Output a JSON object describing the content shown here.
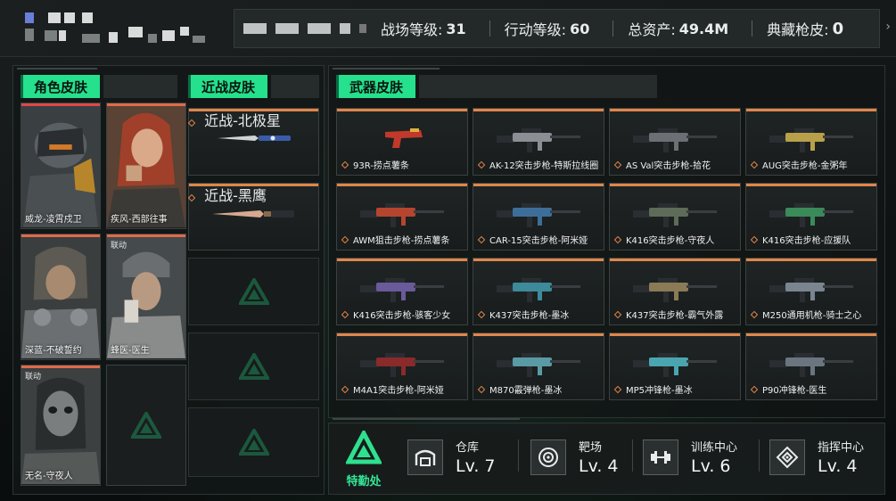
{
  "header": {
    "stats": [
      {
        "label": "战场等级:",
        "value": "31"
      },
      {
        "label": "行动等级:",
        "value": "60"
      },
      {
        "label": "总资产:",
        "value": "49.4M"
      },
      {
        "label": "典藏枪皮:",
        "value": "0"
      }
    ],
    "arrow_icon": "chevron-right-icon"
  },
  "sections": {
    "character": "角色皮肤",
    "melee": "近战皮肤",
    "weapon": "武器皮肤"
  },
  "characters": [
    {
      "name": "威龙-凌霄戍卫",
      "badge": ""
    },
    {
      "name": "疾风-西部往事",
      "badge": ""
    },
    {
      "name": "深蓝-不破誓约",
      "badge": ""
    },
    {
      "name": "蜂医-医生",
      "badge": "联动"
    },
    {
      "name": "无名-守夜人",
      "badge": "联动"
    }
  ],
  "melee": [
    {
      "name": "近战-北极星"
    },
    {
      "name": "近战-黑鹰"
    }
  ],
  "weapons": [
    {
      "name": "93R-捞点薯条",
      "color": "#c0392b"
    },
    {
      "name": "AK-12突击步枪-特斯拉线圈",
      "color": "#8a8f94"
    },
    {
      "name": "AS Val突击步枪-拾花",
      "color": "#6b7075"
    },
    {
      "name": "AUG突击步枪-金粥年",
      "color": "#b8a04a"
    },
    {
      "name": "AWM狙击步枪-捞点薯条",
      "color": "#b5452f"
    },
    {
      "name": "CAR-15突击步枪-阿米娅",
      "color": "#3d6e9a"
    },
    {
      "name": "K416突击步枪-守夜人",
      "color": "#5e6b58"
    },
    {
      "name": "K416突击步枪-应援队",
      "color": "#3a8a5a"
    },
    {
      "name": "K416突击步枪-骇客少女",
      "color": "#6a5a9a"
    },
    {
      "name": "K437突击步枪-墨冰",
      "color": "#3c8a9a"
    },
    {
      "name": "K437突击步枪-霸气外露",
      "color": "#8a7a55"
    },
    {
      "name": "M250通用机枪-骑士之心",
      "color": "#7a8590"
    },
    {
      "name": "M4A1突击步枪-阿米娅",
      "color": "#8a2a2a"
    },
    {
      "name": "M870霰弹枪-墨冰",
      "color": "#5a9aa5"
    },
    {
      "name": "MP5冲锋枪-墨冰",
      "color": "#4aa5b0"
    },
    {
      "name": "P90冲锋枪-医生",
      "color": "#6a7580"
    }
  ],
  "facilities": {
    "logo_label": "特勤处",
    "items": [
      {
        "name": "仓库",
        "level": "Lv. 7",
        "icon": "warehouse-icon"
      },
      {
        "name": "靶场",
        "level": "Lv. 4",
        "icon": "target-icon"
      },
      {
        "name": "训练中心",
        "level": "Lv. 6",
        "icon": "dumbbell-icon"
      },
      {
        "name": "指挥中心",
        "level": "Lv. 4",
        "icon": "command-icon"
      }
    ]
  },
  "colors": {
    "accent_green": "#25e08c",
    "rarity_orange": "#e0864a",
    "rarity_red": "#e04848"
  }
}
